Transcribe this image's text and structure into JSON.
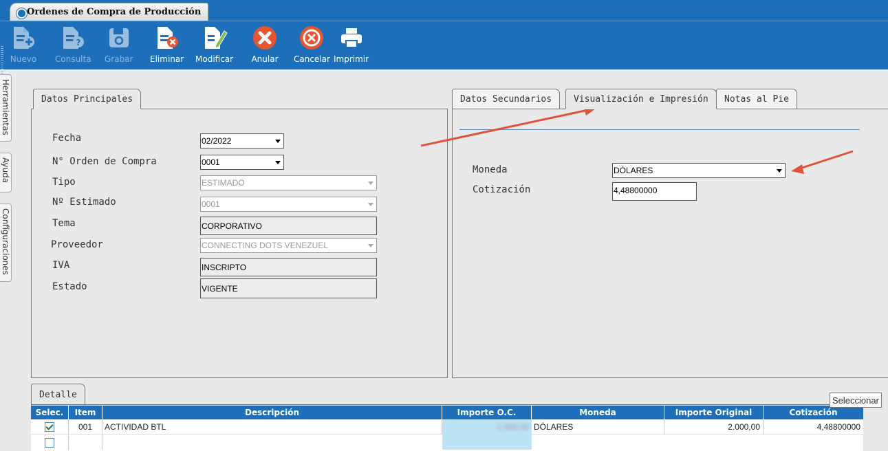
{
  "window": {
    "title": "Ordenes de Compra de Producción"
  },
  "toolbar": {
    "buttons": [
      {
        "label": "Nuevo",
        "icon": "new-document-icon",
        "enabled": false
      },
      {
        "label": "Consulta",
        "icon": "query-document-icon",
        "enabled": false
      },
      {
        "label": "Grabar",
        "icon": "save-disk-icon",
        "enabled": false
      },
      {
        "label": "Eliminar",
        "icon": "delete-document-icon",
        "enabled": true
      },
      {
        "label": "Modificar",
        "icon": "edit-document-icon",
        "enabled": true
      },
      {
        "label": "Anular",
        "icon": "cancel-x-icon",
        "enabled": true
      },
      {
        "label": "Cancelar",
        "icon": "cancel-circle-icon",
        "enabled": true
      },
      {
        "label": "Imprimir",
        "icon": "printer-icon",
        "enabled": true
      }
    ]
  },
  "side_tabs": [
    "Herramientas",
    "Ayuda",
    "Configuraciones"
  ],
  "left_panel": {
    "tab": "Datos Principales",
    "fields": {
      "fecha": {
        "label": "Fecha",
        "value": "02/2022"
      },
      "orden": {
        "label": "N° Orden de Compra",
        "value": "0001"
      },
      "tipo": {
        "label": "Tipo",
        "value": "ESTIMADO"
      },
      "estimado": {
        "label": "Nº Estimado",
        "value": "0001"
      },
      "tema": {
        "label": "Tema",
        "value": "CORPORATIVO"
      },
      "proveedor": {
        "label": "Proveedor",
        "value": "CONNECTING DOTS VENEZUEL"
      },
      "iva": {
        "label": "IVA",
        "value": "INSCRIPTO"
      },
      "estado": {
        "label": "Estado",
        "value": "VIGENTE"
      }
    }
  },
  "right_panel": {
    "tabs": [
      "Datos Secundarios",
      "Visualización e Impresión",
      "Notas al Pie"
    ],
    "active_tab": "Visualización e Impresión",
    "fields": {
      "moneda": {
        "label": "Moneda",
        "value": "DÓLARES"
      },
      "cotizacion": {
        "label": "Cotización",
        "value": "4,48800000"
      }
    }
  },
  "annotation_color": "#e0533a",
  "detail": {
    "tab": "Detalle",
    "tooltip": "Seleccionar",
    "columns": [
      "Selec.",
      "Item",
      "Descripción",
      "Importe O.C.",
      "Moneda",
      "Importe Original",
      "Cotización"
    ],
    "rows": [
      {
        "selected": true,
        "item": "001",
        "descripcion": "ACTIVIDAD BTL",
        "importe_oc": "2.000,00",
        "moneda": "DÓLARES",
        "importe_original": "2.000,00",
        "cotizacion": "4,48800000"
      },
      {
        "selected": false,
        "item": "",
        "descripcion": "",
        "importe_oc": "",
        "moneda": "",
        "importe_original": "",
        "cotizacion": ""
      }
    ]
  }
}
